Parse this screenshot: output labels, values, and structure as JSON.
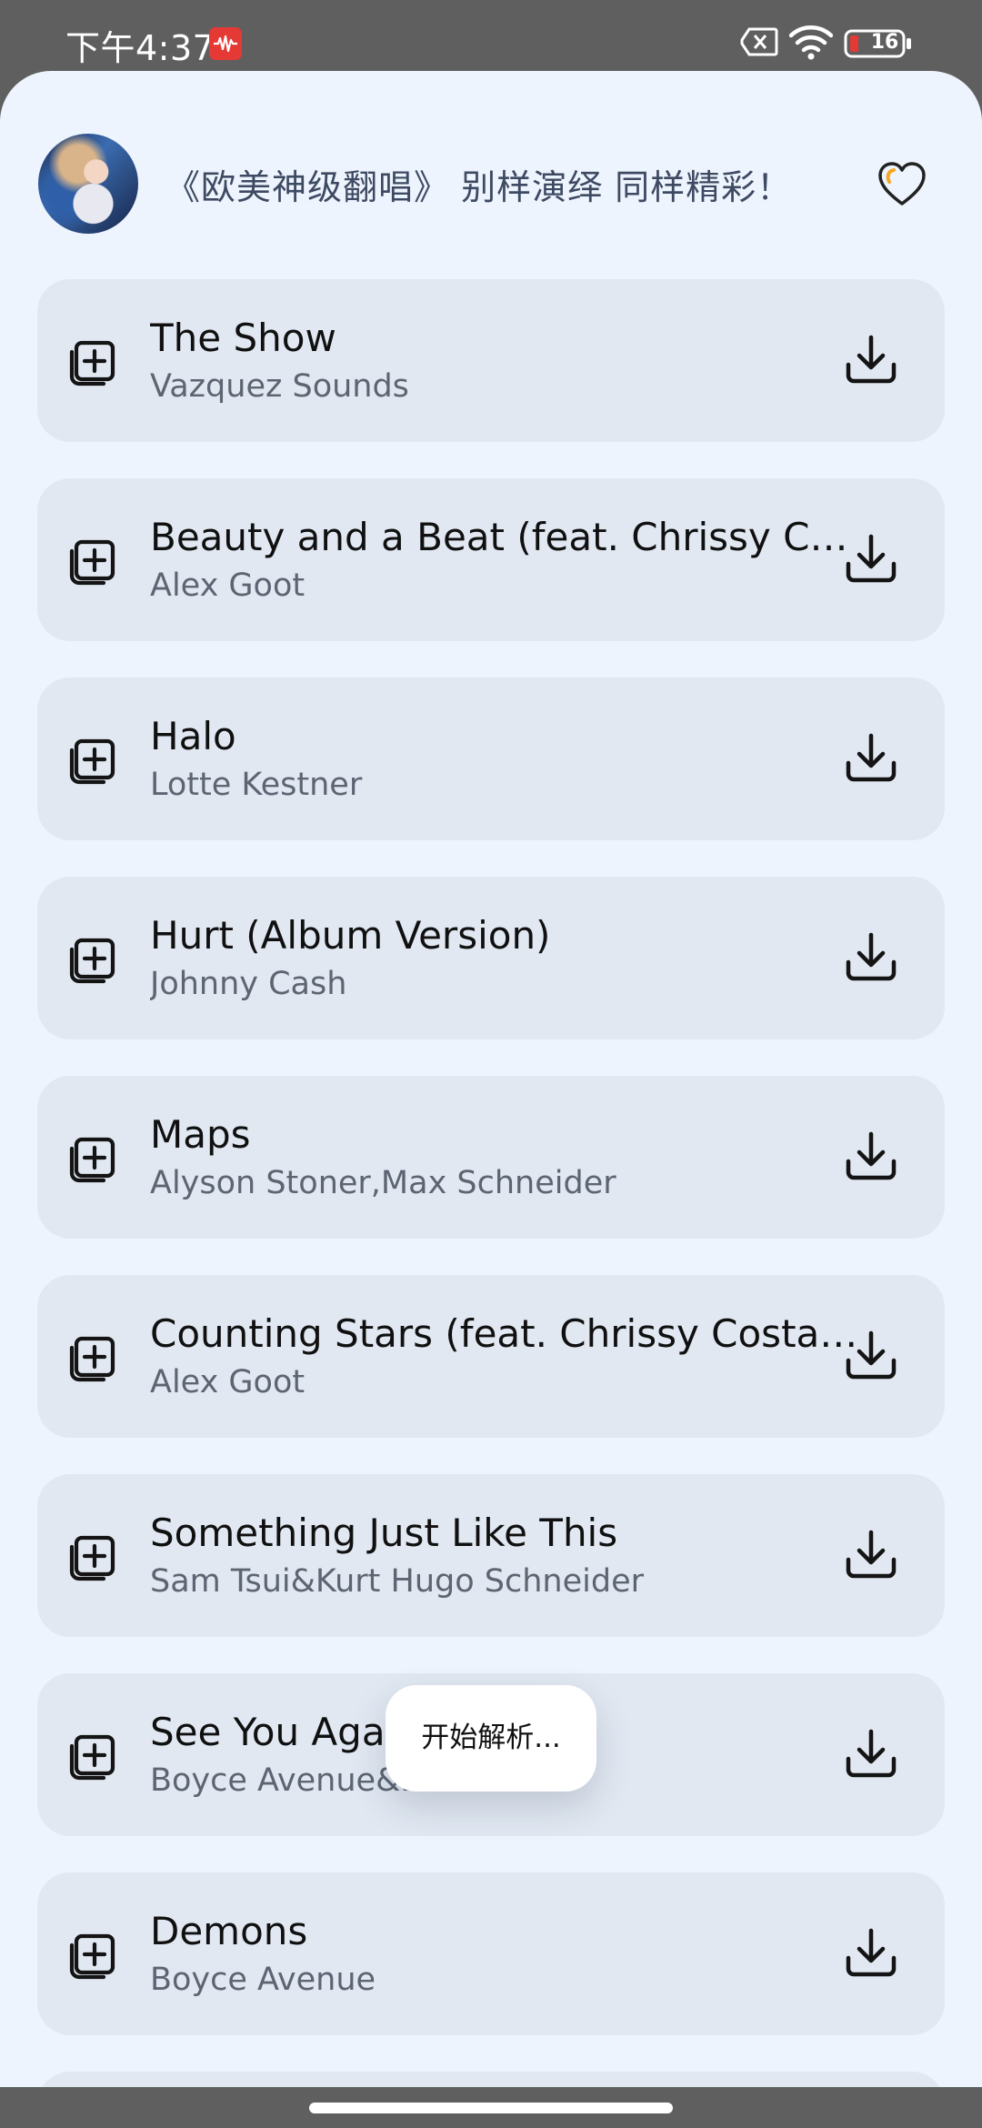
{
  "status_bar": {
    "time": "下午4:37",
    "battery_level": "16",
    "icons": [
      "recording-icon",
      "sim-off-icon",
      "wifi-icon",
      "battery-icon"
    ]
  },
  "header": {
    "playlist_title": "《欧美神级翻唱》 别样演绎 同样精彩！",
    "favorite_icon": "heart-icon"
  },
  "songs": [
    {
      "title": "The Show",
      "artist": "Vazquez Sounds"
    },
    {
      "title": "Beauty and a Beat (feat. Chrissy Costanza)",
      "artist": "Alex Goot"
    },
    {
      "title": "Halo",
      "artist": "Lotte Kestner"
    },
    {
      "title": "Hurt (Album Version)",
      "artist": "Johnny Cash"
    },
    {
      "title": "Maps",
      "artist": "Alyson Stoner,Max Schneider"
    },
    {
      "title": "Counting Stars (feat. Chrissy Costanza)",
      "artist": "Alex Goot"
    },
    {
      "title": "Something Just Like This",
      "artist": "Sam Tsui&Kurt Hugo Schneider"
    },
    {
      "title": "See You Again",
      "artist": "Boyce Avenue&Bea Miller"
    },
    {
      "title": "Demons",
      "artist": "Boyce Avenue"
    }
  ],
  "toast": {
    "message": "开始解析..."
  },
  "colors": {
    "background": "#eef4fd",
    "card": "#e1e8f2",
    "status_bar": "#5f5f5f",
    "recording": "#e53935",
    "battery_low": "#e53935",
    "heart_accent": "#f5a623"
  }
}
